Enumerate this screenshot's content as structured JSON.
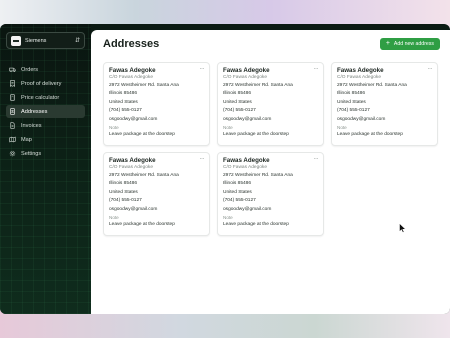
{
  "org": {
    "name": "Siemens"
  },
  "nav": [
    {
      "label": "Orders",
      "icon": "truck-icon"
    },
    {
      "label": "Proof of delivery",
      "icon": "receipt-icon"
    },
    {
      "label": "Price calculator",
      "icon": "calculator-icon"
    },
    {
      "label": "Addresses",
      "icon": "book-icon",
      "active": true
    },
    {
      "label": "Invoices",
      "icon": "invoice-icon"
    },
    {
      "label": "Map",
      "icon": "map-icon"
    },
    {
      "label": "Settings",
      "icon": "gear-icon"
    }
  ],
  "page": {
    "title": "Addresses",
    "add_button": "Add new address"
  },
  "addresses": [
    {
      "name": "Fawas Adegoke",
      "care_of": "C/O Fawas Adegoke",
      "street": "2972 Westheimer Rd. Santa Ana",
      "region": "Illinois 85486",
      "country": "United States",
      "phone": "(704) 555-0127",
      "email": "osgoodwy@gmail.com",
      "note_label": "Note",
      "note": "Leave package at the doorstep"
    },
    {
      "name": "Fawas Adegoke",
      "care_of": "C/O Fawas Adegoke",
      "street": "2972 Westheimer Rd. Santa Ana",
      "region": "Illinois 85486",
      "country": "United States",
      "phone": "(704) 555-0127",
      "email": "osgoodwy@gmail.com",
      "note_label": "Note",
      "note": "Leave package at the doorstep"
    },
    {
      "name": "Fawas Adegoke",
      "care_of": "C/O Fawas Adegoke",
      "street": "2972 Westheimer Rd. Santa Ana",
      "region": "Illinois 85486",
      "country": "United States",
      "phone": "(704) 555-0127",
      "email": "osgoodwy@gmail.com",
      "note_label": "Note",
      "note": "Leave package at the doorstep"
    },
    {
      "name": "Fawas Adegoke",
      "care_of": "C/O Fawas Adegoke",
      "street": "2972 Westheimer Rd. Santa Ana",
      "region": "Illinois 85486",
      "country": "United States",
      "phone": "(704) 555-0127",
      "email": "osgoodwy@gmail.com",
      "note_label": "Note",
      "note": "Leave package at the doorstep"
    },
    {
      "name": "Fawas Adegoke",
      "care_of": "C/O Fawas Adegoke",
      "street": "2972 Westheimer Rd. Santa Ana",
      "region": "Illinois 85486",
      "country": "United States",
      "phone": "(704) 555-0127",
      "email": "osgoodwy@gmail.com",
      "note_label": "Note",
      "note": "Leave package at the doorstep"
    }
  ],
  "colors": {
    "accent": "#2f9e44",
    "sidebar_bg": "#0b1a13",
    "active_item": "#2a3a31"
  }
}
